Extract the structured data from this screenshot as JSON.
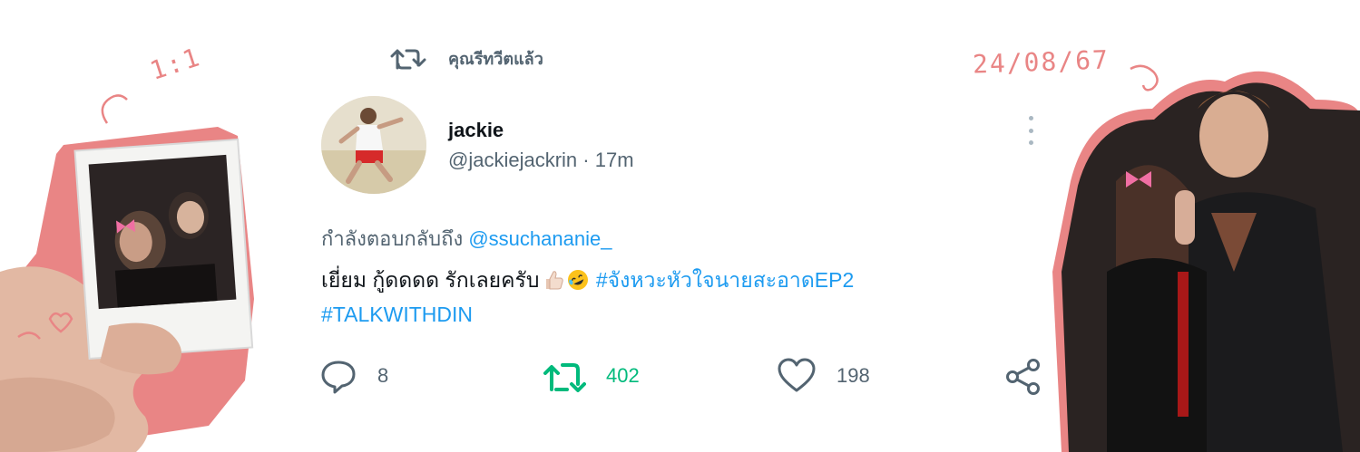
{
  "decorations": {
    "left_note": "1:1",
    "right_note": "24/08/67"
  },
  "retweet_header": {
    "icon": "retweet-icon",
    "label": "คุณรีทวีตแล้ว"
  },
  "tweet": {
    "display_name": "jackie",
    "handle": "@jackiejackrin",
    "separator": " · ",
    "time": "17m",
    "reply_prefix": "กำลังตอบกลับถึง",
    "reply_mention": "@ssuchananie_",
    "text_main": "เยี่ยม กู้ดดดด รักเลยครับ",
    "emojis": [
      "thumbs-up-light-skin-emoji",
      "rolling-on-floor-laughing-emoji"
    ],
    "hashtag_1": "#จังหวะหัวใจนายสะอาดEP2",
    "hashtag_2": "#TALKWITHDIN"
  },
  "actions": {
    "reply_count": "8",
    "retweet_count": "402",
    "like_count": "198"
  },
  "colors": {
    "link": "#1d9bf0",
    "retweet_active": "#00ba7c",
    "muted": "#536471",
    "text": "#0f1419",
    "handwriting": "#e98585"
  }
}
